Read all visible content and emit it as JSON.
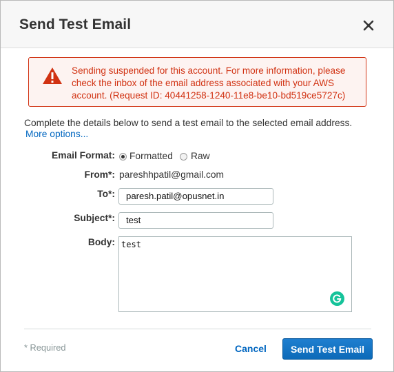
{
  "dialog": {
    "title": "Send Test Email",
    "close_icon": "close-icon"
  },
  "alert": {
    "icon": "warning-icon",
    "message": "Sending suspended for this account. For more information, please check the inbox of the email address associated with your AWS account. (Request ID: 40441258-1240-11e8-be10-bd519ce5727c)",
    "color": "#d13212"
  },
  "intro": {
    "text": "Complete the details below to send a test email to the selected email address.",
    "more_options_link": "More options..."
  },
  "form": {
    "email_format": {
      "label": "Email Format:",
      "options": [
        "Formatted",
        "Raw"
      ],
      "selected": "Formatted"
    },
    "from": {
      "label": "From*:",
      "value": "pareshhpatil@gmail.com"
    },
    "to": {
      "label": "To*:",
      "value": "paresh.patil@opusnet.in"
    },
    "subject": {
      "label": "Subject*:",
      "value": "test"
    },
    "body": {
      "label": "Body:",
      "value": "test",
      "grammarly_icon": "grammarly-icon"
    }
  },
  "footer": {
    "required_note": "* Required",
    "cancel_label": "Cancel",
    "submit_label": "Send Test Email",
    "accent_color": "#0066c0"
  }
}
